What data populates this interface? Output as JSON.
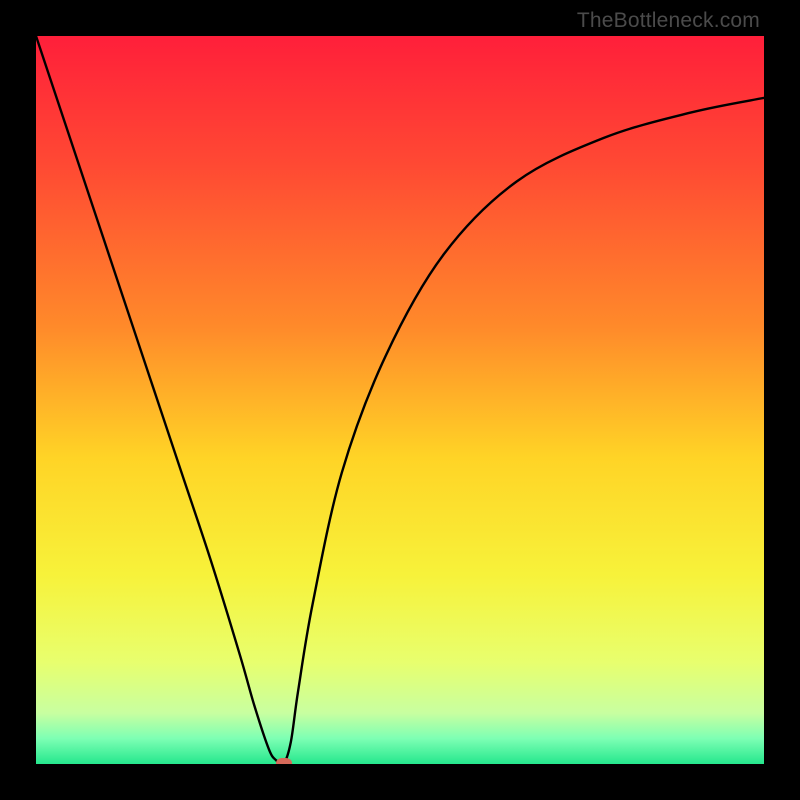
{
  "watermark": "TheBottleneck.com",
  "chart_data": {
    "type": "line",
    "title": "",
    "xlabel": "",
    "ylabel": "",
    "xlim": [
      0,
      100
    ],
    "ylim": [
      0,
      100
    ],
    "gradient_stops": [
      {
        "offset": 0.0,
        "color": "#ff1f3a"
      },
      {
        "offset": 0.18,
        "color": "#ff4a33"
      },
      {
        "offset": 0.4,
        "color": "#ff8a2a"
      },
      {
        "offset": 0.58,
        "color": "#ffd426"
      },
      {
        "offset": 0.74,
        "color": "#f7f23a"
      },
      {
        "offset": 0.86,
        "color": "#e8ff6e"
      },
      {
        "offset": 0.93,
        "color": "#c8ffa0"
      },
      {
        "offset": 0.965,
        "color": "#7dffb4"
      },
      {
        "offset": 1.0,
        "color": "#25e78d"
      }
    ],
    "series": [
      {
        "name": "bottleneck-curve",
        "x": [
          0,
          4,
          8,
          12,
          16,
          20,
          24,
          28,
          30,
          32,
          33,
          34,
          35,
          36,
          38,
          42,
          48,
          56,
          66,
          78,
          90,
          100
        ],
        "y": [
          100,
          88,
          76,
          64,
          52,
          40,
          28,
          15,
          8,
          2,
          0.5,
          0,
          3,
          10,
          22,
          40,
          56,
          70,
          80,
          86,
          89.5,
          91.5
        ]
      }
    ],
    "marker": {
      "x": 34,
      "y": 0,
      "color": "#d66a5a"
    }
  }
}
